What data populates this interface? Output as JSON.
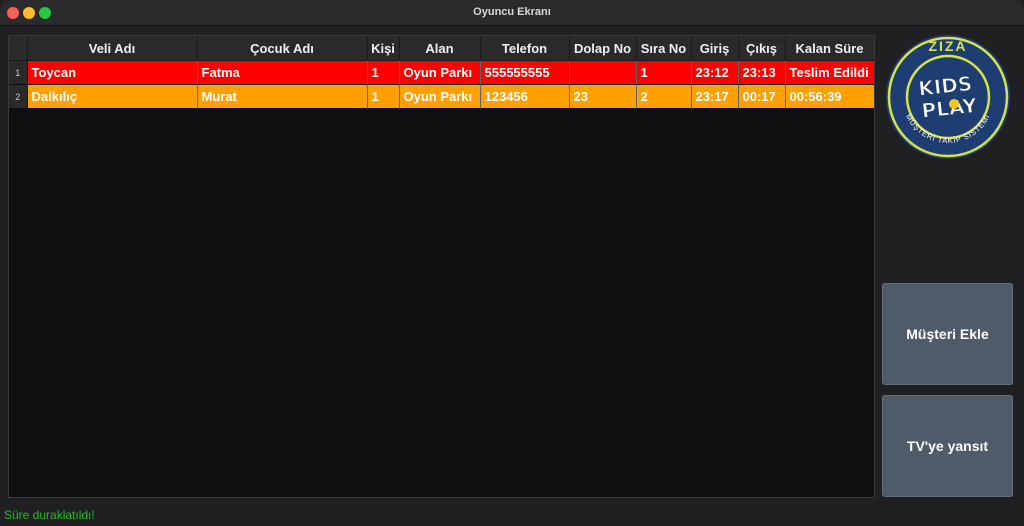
{
  "window": {
    "title": "Oyuncu Ekranı"
  },
  "table": {
    "columns": [
      "",
      "Veli Adı",
      "Çocuk Adı",
      "Kişi",
      "Alan",
      "Telefon",
      "Dolap No",
      "Sıra No",
      "Giriş",
      "Çıkış",
      "Kalan Süre"
    ],
    "rows": [
      {
        "num": "1",
        "status": "red",
        "veli": "Toycan",
        "cocuk": "Fatma",
        "kisi": "1",
        "alan": "Oyun Parkı",
        "telefon": "555555555",
        "dolap": "",
        "sira": "1",
        "giris": "23:12",
        "cikis": "23:13",
        "kalan": "Teslim Edildi"
      },
      {
        "num": "2",
        "status": "orange",
        "veli": "Dalkılıç",
        "cocuk": "Murat",
        "kisi": "1",
        "alan": "Oyun Parkı",
        "telefon": "123456",
        "dolap": "23",
        "sira": "2",
        "giris": "23:17",
        "cikis": "00:17",
        "kalan": "00:56:39"
      }
    ]
  },
  "logo": {
    "brand": "ZIZA",
    "line1": "KIDS",
    "line2": "PLAY",
    "ring_text": "MÜŞTERİ TAKİP SİSTEMİ"
  },
  "buttons": {
    "add_customer": "Müşteri Ekle",
    "tv_mirror": "TV'ye yansıt"
  },
  "status_text": "Süre duraklatıldı!",
  "colors": {
    "row_red": "#fe0000",
    "row_orange": "#ffa000",
    "status_green": "#18c418",
    "logo_navy": "#1e3d72",
    "logo_lime": "#d7e24a"
  }
}
